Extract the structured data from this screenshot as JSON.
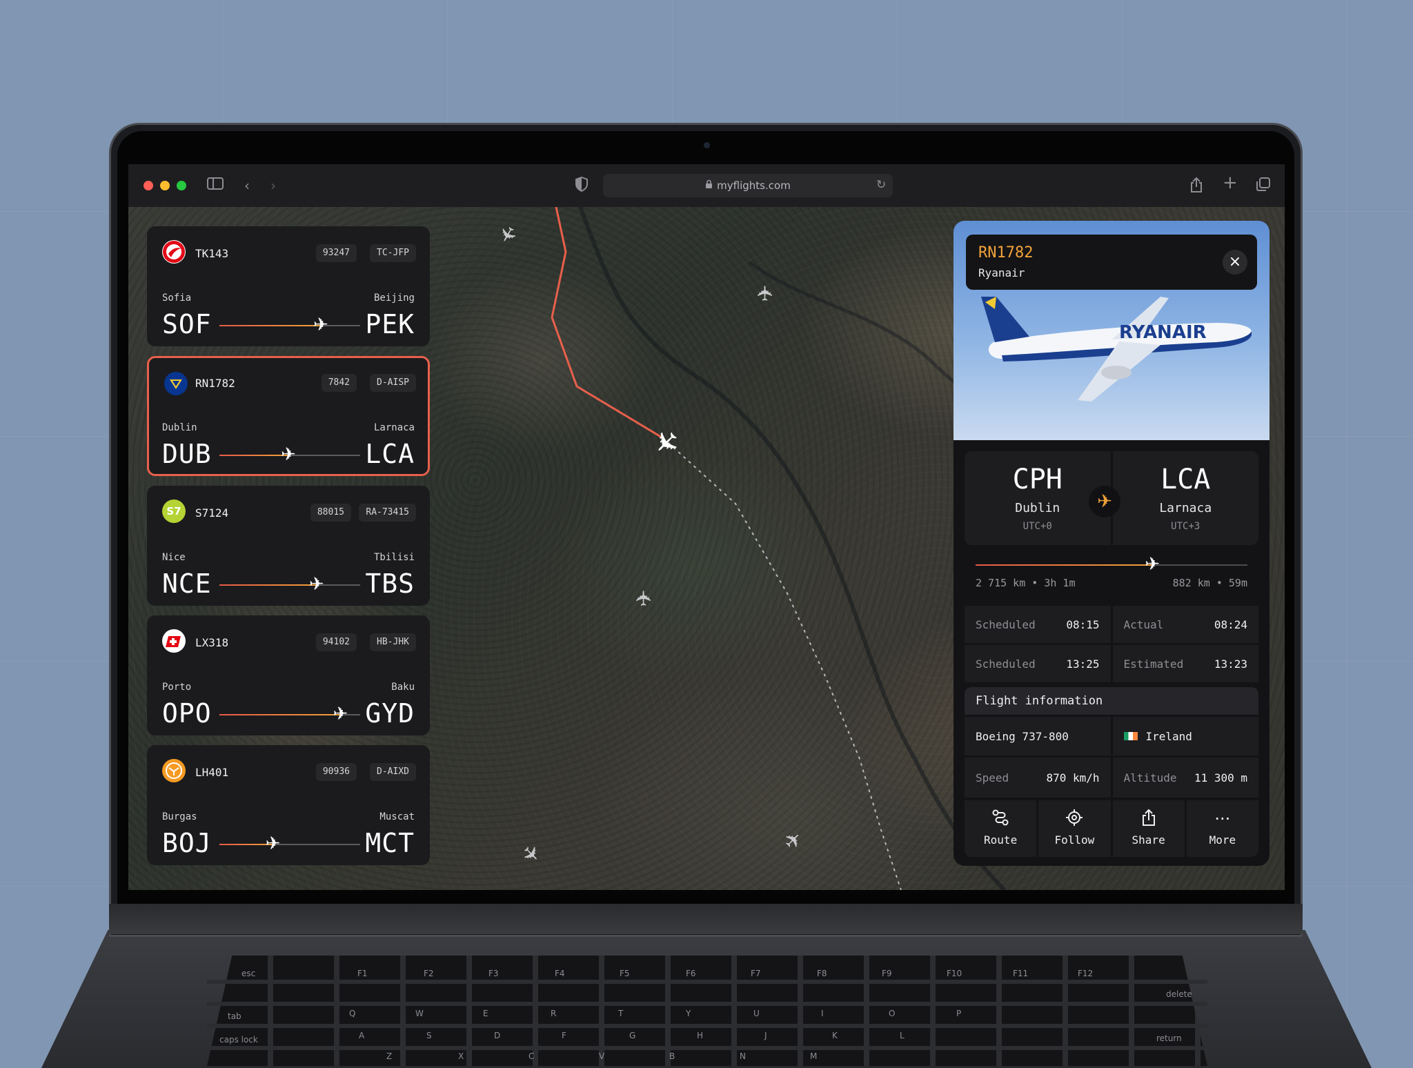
{
  "browser": {
    "url": "myflights.com",
    "traffic_lights": {
      "close": "#ff5f57",
      "minimize": "#febc2e",
      "zoom": "#28c840"
    },
    "icons": [
      "sidebar-icon",
      "back-icon",
      "forward-icon",
      "shield-icon",
      "lock-icon",
      "reload-icon",
      "share-icon",
      "new-tab-icon",
      "tabs-icon"
    ]
  },
  "accent": {
    "orange": "#f2a23a",
    "red": "#e8604c"
  },
  "flights": [
    {
      "number": "TK143",
      "tag1": "93247",
      "tag2": "TC-JFP",
      "from_city": "Sofia",
      "from_code": "SOF",
      "to_city": "Beijing",
      "to_code": "PEK",
      "progress": 0.72,
      "logo_color": "#e30a17",
      "logo_icon": "turkish-airlines-logo",
      "active": false
    },
    {
      "number": "RN1782",
      "tag1": "7842",
      "tag2": "D-AISP",
      "from_city": "Dublin",
      "from_code": "DUB",
      "to_city": "Larnaca",
      "to_code": "LCA",
      "progress": 0.49,
      "logo_color": "#073590",
      "logo_icon": "ryanair-logo",
      "active": true
    },
    {
      "number": "S7124",
      "tag1": "88015",
      "tag2": "RA-73415",
      "from_city": "Nice",
      "from_code": "NCE",
      "to_city": "Tbilisi",
      "to_code": "TBS",
      "progress": 0.69,
      "logo_color": "#b5d334",
      "logo_icon": "s7-logo",
      "active": false
    },
    {
      "number": "LX318",
      "tag1": "94102",
      "tag2": "HB-JHK",
      "from_city": "Porto",
      "from_code": "OPO",
      "to_city": "Baku",
      "to_code": "GYD",
      "progress": 0.86,
      "logo_color": "#ffffff",
      "logo_icon": "swiss-logo",
      "active": false
    },
    {
      "number": "LH401",
      "tag1": "90936",
      "tag2": "D-AIXD",
      "from_city": "Burgas",
      "from_code": "BOJ",
      "to_city": "Muscat",
      "to_code": "MCT",
      "progress": 0.38,
      "logo_color": "#f59a23",
      "logo_icon": "lufthansa-logo",
      "active": false
    }
  ],
  "detail": {
    "flight_number": "RN1782",
    "airline": "Ryanair",
    "image_text": "RYANAIR",
    "origin": {
      "code": "CPH",
      "city": "Dublin",
      "tz": "UTC+0"
    },
    "destination": {
      "code": "LCA",
      "city": "Larnaca",
      "tz": "UTC+3"
    },
    "progress": 0.65,
    "left_distance": "2 715 km • 3h 1m",
    "right_distance": "882 km • 59m",
    "times": [
      {
        "k1": "Scheduled",
        "v1": "08:15",
        "k2": "Actual",
        "v2": "08:24"
      },
      {
        "k1": "Scheduled",
        "v1": "13:25",
        "k2": "Estimated",
        "v2": "13:23"
      }
    ],
    "info_title": "Flight information",
    "aircraft": "Boeing 737-800",
    "country": "Ireland",
    "speed_label": "Speed",
    "speed": "870 km/h",
    "altitude_label": "Altitude",
    "altitude": "11 300 m",
    "actions": [
      {
        "label": "Route",
        "icon": "route-icon"
      },
      {
        "label": "Follow",
        "icon": "crosshair-icon"
      },
      {
        "label": "Share",
        "icon": "share-icon"
      },
      {
        "label": "More",
        "icon": "more-icon"
      }
    ]
  },
  "keyboard": {
    "labels": [
      "esc",
      "F1",
      "F2",
      "F3",
      "F4",
      "F5",
      "F6",
      "F7",
      "F8",
      "F9",
      "F10",
      "F11",
      "F12",
      "tab",
      "caps lock",
      "delete",
      "return",
      "Q",
      "W",
      "E",
      "R",
      "T",
      "Y",
      "U",
      "I",
      "O",
      "P",
      "A",
      "S",
      "D",
      "F",
      "G",
      "H",
      "J",
      "K",
      "L",
      "Z",
      "X",
      "C",
      "V",
      "B",
      "N",
      "M"
    ]
  }
}
